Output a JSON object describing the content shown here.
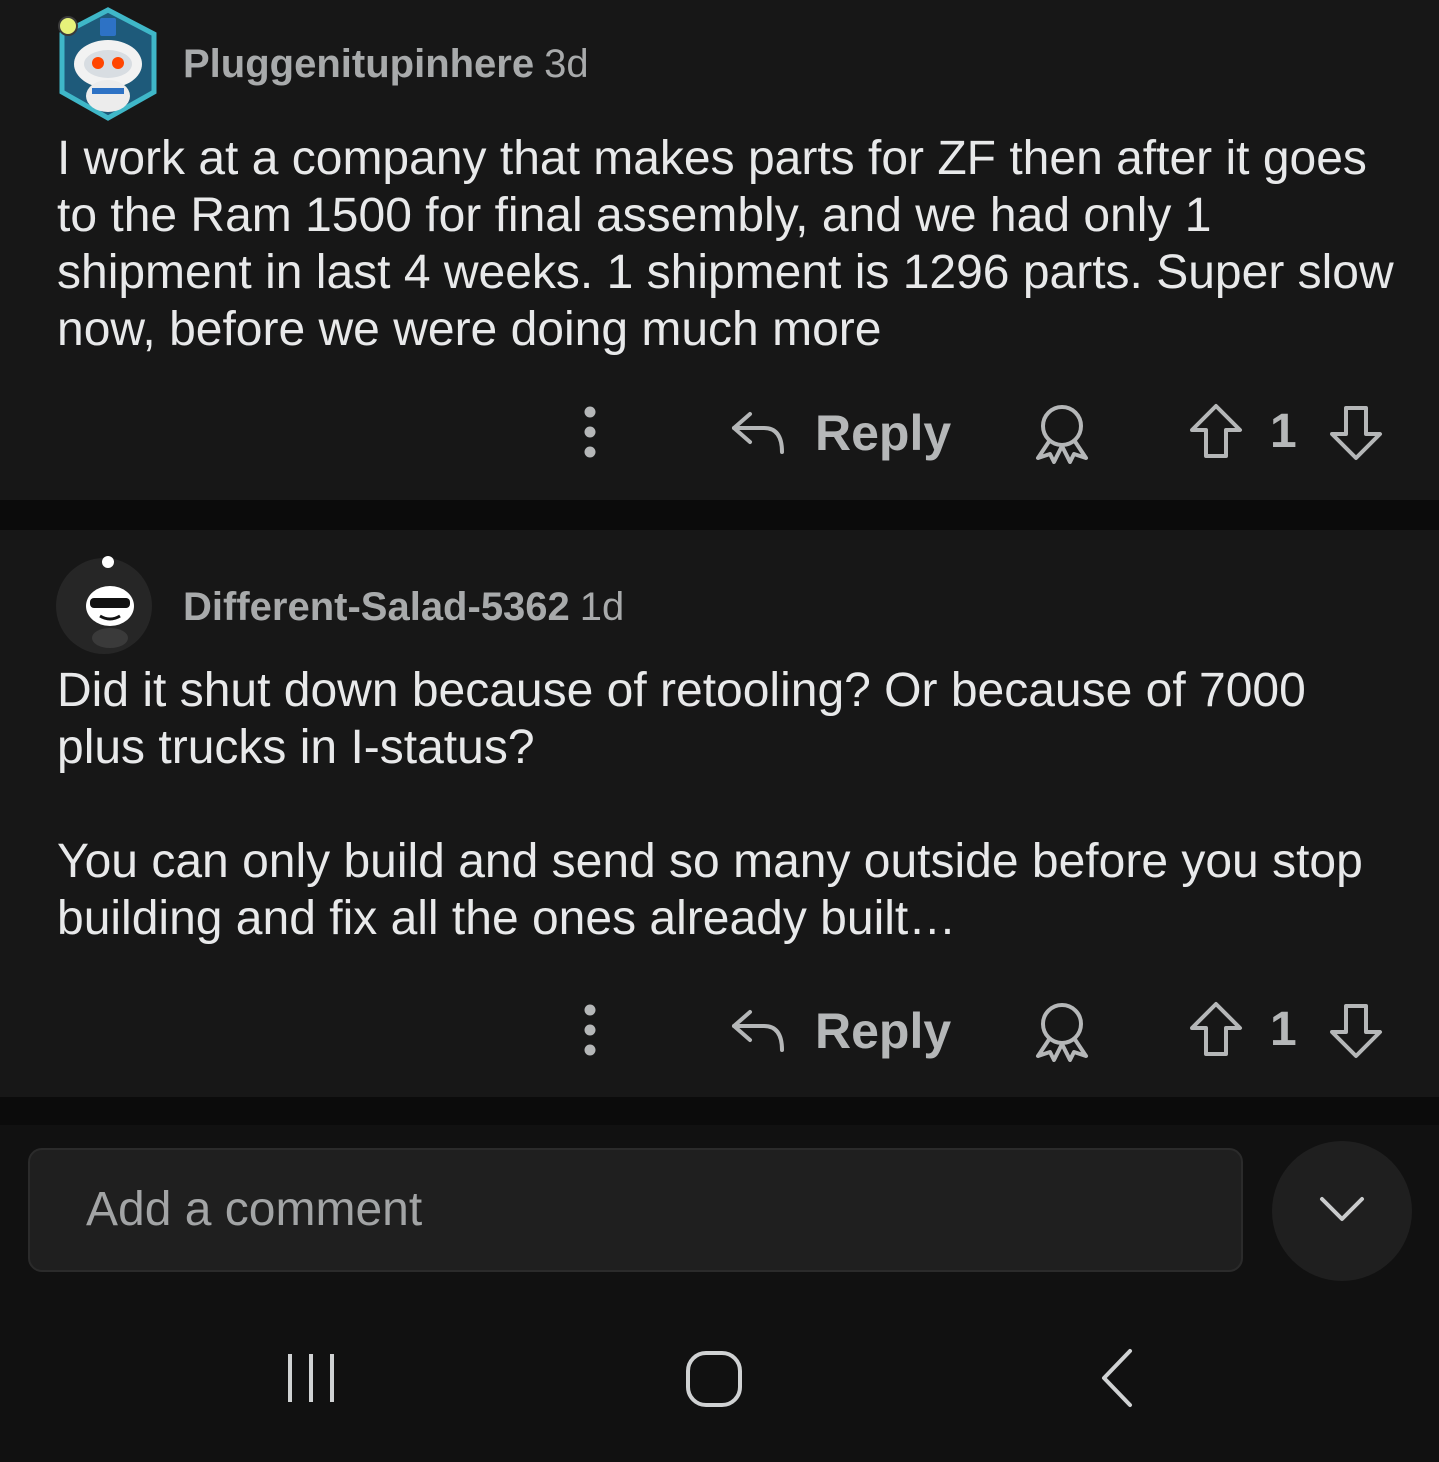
{
  "comments": [
    {
      "username": "Pluggenitupinhere",
      "time": "3d",
      "body": [
        "I work at a company that makes parts for ZF then after it goes to the Ram 1500 for final assembly, and we had only 1 shipment in last 4 weeks. 1 shipment is 1296 parts. Super slow now, before we were doing much more"
      ],
      "reply_label": "Reply",
      "score": "1"
    },
    {
      "username": "Different-Salad-5362",
      "time": "1d",
      "body": [
        "Did it shut down because of retooling? Or because of 7000 plus trucks in I-status?",
        "You can only build and send so many outside before you stop building and fix all the ones already built…"
      ],
      "reply_label": "Reply",
      "score": "1"
    }
  ],
  "composer": {
    "placeholder": "Add a comment"
  },
  "icons": {
    "more": "kebab-menu-icon",
    "reply": "reply-arrow-icon",
    "award": "award-ribbon-icon",
    "upvote": "upvote-arrow-icon",
    "downvote": "downvote-arrow-icon",
    "collapse": "chevron-down-icon",
    "nav_recent": "recent-apps-icon",
    "nav_home": "home-icon",
    "nav_back": "back-icon"
  },
  "colors": {
    "background": "#0b0b0b",
    "card": "#171717",
    "text": "#e8e9ea",
    "muted": "#a8aaab",
    "avatar_ring": "#3fb7c8"
  }
}
